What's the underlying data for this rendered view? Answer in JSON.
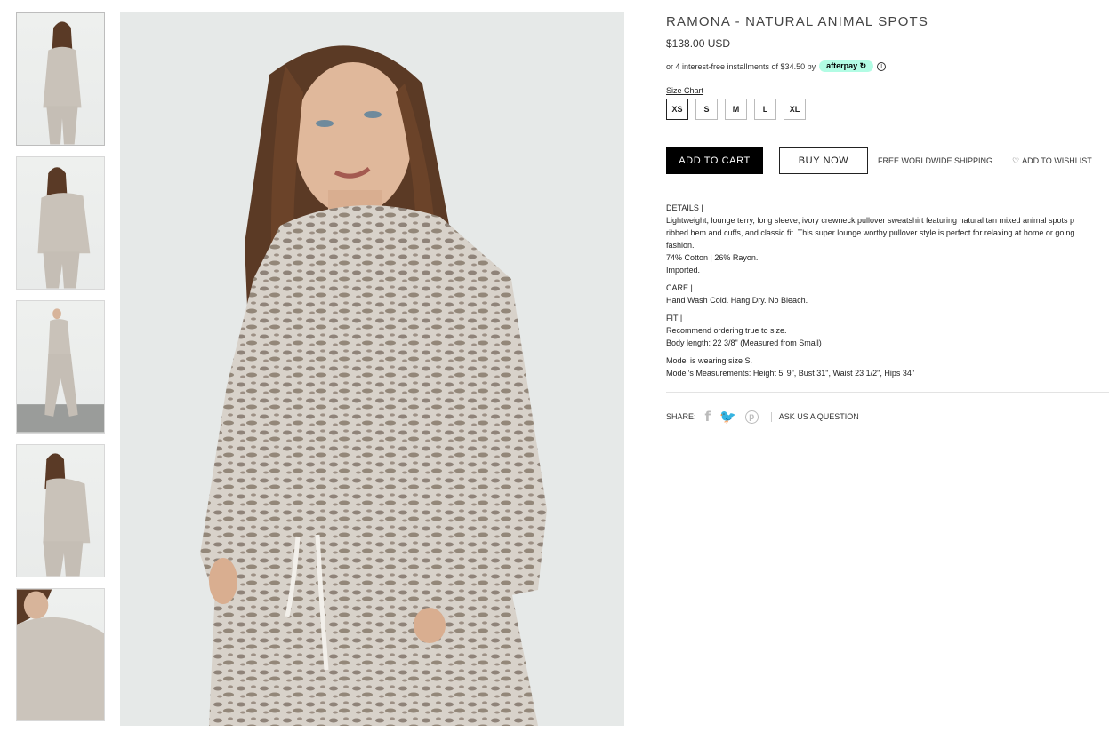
{
  "product": {
    "title": "RAMONA - NATURAL ANIMAL SPOTS",
    "price": "$138.00 USD",
    "installments_prefix": "or 4 interest-free installments of $34.50 by",
    "afterpay_label": "afterpay",
    "size_chart_label": "Size Chart",
    "sizes": [
      "XS",
      "S",
      "M",
      "L",
      "XL"
    ],
    "selected_size": "XS",
    "add_to_cart": "ADD TO CART",
    "buy_now": "BUY NOW",
    "shipping": "FREE WORLDWIDE SHIPPING",
    "wishlist": "ADD TO WISHLIST"
  },
  "description": {
    "details_heading": "DETAILS |",
    "details_text": "Lightweight, lounge terry, long sleeve, ivory crewneck pullover sweatshirt featuring natural tan mixed animal spots p",
    "details_text_2": "ribbed hem and cuffs, and classic fit. This super lounge worthy pullover style is perfect for relaxing at home or going",
    "details_text_3": "fashion.",
    "fabric": "74% Cotton | 26% Rayon.",
    "origin": "Imported.",
    "care_heading": "CARE |",
    "care_text": "Hand Wash Cold. Hang Dry. No Bleach.",
    "fit_heading": "FIT |",
    "fit_text": "Recommend ordering true to size.",
    "body_length": "Body length: 22 3/8\" (Measured from Small)",
    "model_size": "Model is wearing size S.",
    "model_measurements": "Model’s Measurements: Height 5’ 9\", Bust 31\", Waist 23 1/2\", Hips 34\""
  },
  "share": {
    "label": "SHARE:",
    "icons": [
      "facebook-icon",
      "twitter-icon",
      "pinterest-icon"
    ],
    "ask": "ASK US A QUESTION"
  },
  "colors": {
    "afterpay_bg": "#b2fce4",
    "button_primary": "#000000"
  }
}
